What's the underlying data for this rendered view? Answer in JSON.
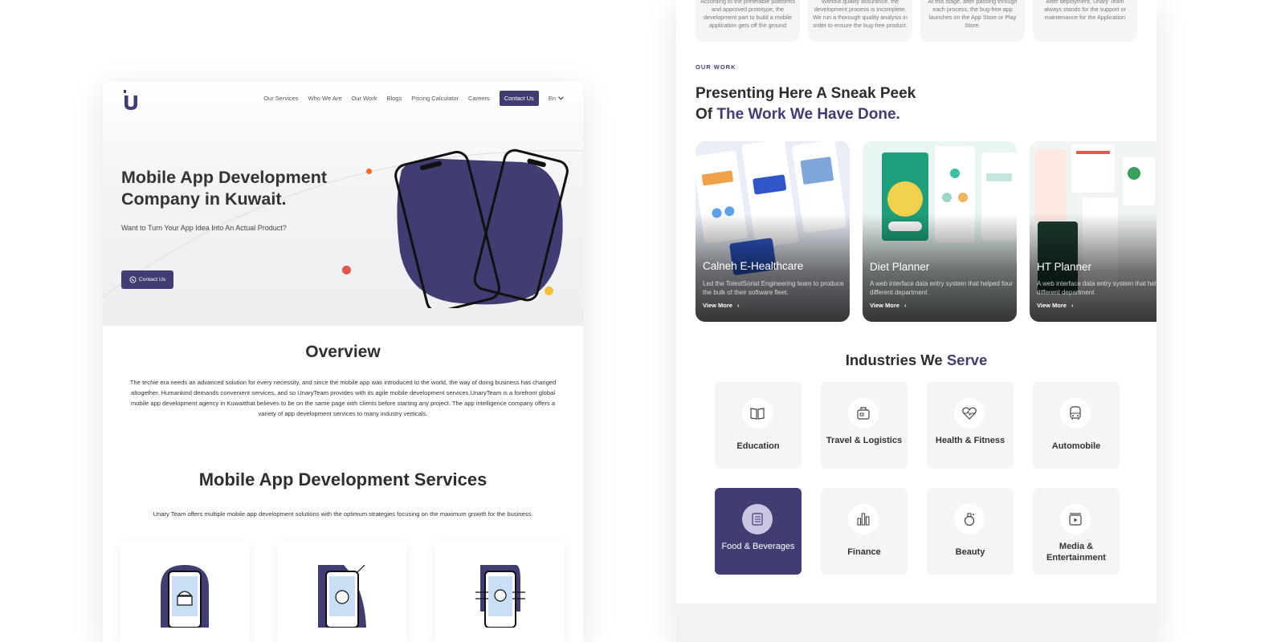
{
  "left": {
    "nav": {
      "items": [
        "Our Services",
        "Who We Are",
        "Our Work",
        "Blogs",
        "Pricing Calculator",
        "Careers"
      ],
      "cta": "Contact Us",
      "lang": "En"
    },
    "hero": {
      "title": "Mobile App Development Company in Kuwait.",
      "subtitle": "Want to Turn Your App Idea Into An Actual Product?",
      "button": "Contact Us"
    },
    "overview": {
      "heading": "Overview",
      "text": "The techie era needs an advanced solution for every necessity, and since the mobile app was introduced to the world, the way of doing business has changed altogether. Humankind demands convenient services, and so UnaryTeam provides with its agile mobile development services.UnaryTeam is a forefront global mobile app development agency in Kuwaitthat believes to be on the same page with clients before starting any project. The app intelligence company offers a variety of app development services to many industry verticals."
    },
    "services": {
      "heading": "Mobile App Development Services",
      "text": "Unary Team offers multiple mobile app development solutions with the optimum strategies focusing on the maximum growth for the business."
    }
  },
  "right": {
    "process": [
      "According to the preferable platforms and approved prototype, the development part to build a mobile application gets off the ground",
      "Without quality assurance, the development process is incomplete. We run a thorough quality analysis in order to ensure the bug-free product.",
      "At this stage, after passing through each process, the bug-free app launches on the App Store or Play Store.",
      "After deployment, Unary Team always stands for the support or maintenance for the Application"
    ],
    "work": {
      "eyebrow": "OUR WORK",
      "title_line1": "Presenting Here A Sneak Peek",
      "title_of": "Of ",
      "title_accent": "The Work We Have Done.",
      "projects": [
        {
          "title": "Calneh E-Healthcare",
          "desc": "Led the TolestSoriat Engineering team to produce the bulk of their software fleet.",
          "more": "View More"
        },
        {
          "title": "Diet Planner",
          "desc": "A web interface data entry system that helped four different department",
          "more": "View More"
        },
        {
          "title": "HT Planner",
          "desc": "A web interface data entry system that helped four different department",
          "more": "View More"
        }
      ]
    },
    "industries": {
      "title_plain": "Industries We ",
      "title_accent": "Serve",
      "items": [
        {
          "label": "Education",
          "icon": "book-icon"
        },
        {
          "label": "Travel & Logistics",
          "icon": "luggage-icon"
        },
        {
          "label": "Health & Fitness",
          "icon": "heart-pulse-icon"
        },
        {
          "label": "Automobile",
          "icon": "bus-icon"
        },
        {
          "label": "Food & Beverages",
          "icon": "menu-icon"
        },
        {
          "label": "Finance",
          "icon": "bar-chart-icon"
        },
        {
          "label": "Beauty",
          "icon": "perfume-icon"
        },
        {
          "label": "Media & Entertainment",
          "icon": "video-icon"
        }
      ]
    }
  },
  "colors": {
    "accent": "#3f3d72",
    "orange": "#f26b22",
    "red": "#e2574c",
    "yellow": "#f5c03b"
  }
}
